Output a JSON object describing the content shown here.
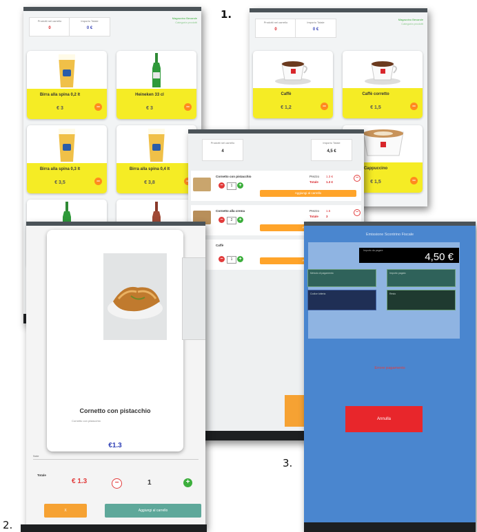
{
  "labels": {
    "one": "1.",
    "two": "2.",
    "three": "3."
  },
  "colors": {
    "accent_yellow": "#f5ec25",
    "accent_orange": "#ff8a1e",
    "price_red": "#d8262b",
    "payment_blue": "#4a86cf",
    "green": "#3cae3c"
  },
  "screen1a": {
    "stats": [
      {
        "label": "Prodotti nel carrello",
        "value": "0"
      },
      {
        "label": "Importo Totale",
        "value": "0 €"
      }
    ],
    "header_right": [
      "Magazzino Bevande",
      "Categoria prodotti"
    ],
    "products": [
      {
        "name": "Birra alla spina 0,2 lt",
        "price": "€ 3",
        "icon": "beer-glass-icon"
      },
      {
        "name": "Heineken 33 cl",
        "price": "€ 3",
        "icon": "beer-bottle-icon"
      },
      {
        "name": "Birra alla spina 0,3 lt",
        "price": "€ 3,5",
        "icon": "beer-glass-icon"
      },
      {
        "name": "Birra alla spina 0,4 lt",
        "price": "€ 3,8",
        "icon": "beer-glass-icon"
      }
    ]
  },
  "screen1b": {
    "stats": [
      {
        "label": "Prodotti nel carrello",
        "value": "0"
      },
      {
        "label": "Importo Totale",
        "value": "0 €"
      }
    ],
    "header_right": [
      "Magazzino Bevande",
      "Categoria prodotti"
    ],
    "products": [
      {
        "name": "Caffè",
        "price": "€ 1,2",
        "icon": "coffee-cup-icon"
      },
      {
        "name": "Caffè corretto",
        "price": "€ 1,5",
        "icon": "coffee-cup-icon"
      },
      {
        "name": "Cappuccino",
        "price": "€ 1,5",
        "icon": "cappuccino-icon"
      }
    ]
  },
  "cart": {
    "stats": [
      {
        "label": "Prodotti nel carrello",
        "value": "4"
      },
      {
        "label": "Importo Totale",
        "value": "4,5 €"
      }
    ],
    "items": [
      {
        "name": "Cornetto con pistacchio",
        "qty": "1",
        "price_label": "Prezzo",
        "price": "1.3 €",
        "total_label": "Totale",
        "total": "1.3 €",
        "button": "Aggiungi al carrello"
      },
      {
        "name": "Cornetto alla crema",
        "qty": "2",
        "price_label": "Prezzo",
        "price": "1.5",
        "total_label": "Totale",
        "total": "3",
        "button": "Aggiungi"
      },
      {
        "name": "Caffè",
        "qty": "1",
        "button": "Aggiungi"
      }
    ]
  },
  "detail": {
    "title": "Cornetto con pistacchio",
    "subtitle": "Cornetto con pistacchio",
    "price": "€1.3",
    "notes_label": "Note",
    "total_label": "Totale",
    "total": "€ 1.3",
    "qty": "1",
    "back_button": "X",
    "add_button": "Aggiungi al carrello"
  },
  "payment": {
    "title": "Emissione Scontrino Fiscale",
    "amount_label": "Importo da pagare",
    "amount": "4,50 €",
    "fields": [
      "Metodo di pagamento",
      "Importo pagato",
      "Codice lotteria",
      "Resto"
    ],
    "error": "Errore pagamento",
    "cancel_button": "Annulla"
  }
}
